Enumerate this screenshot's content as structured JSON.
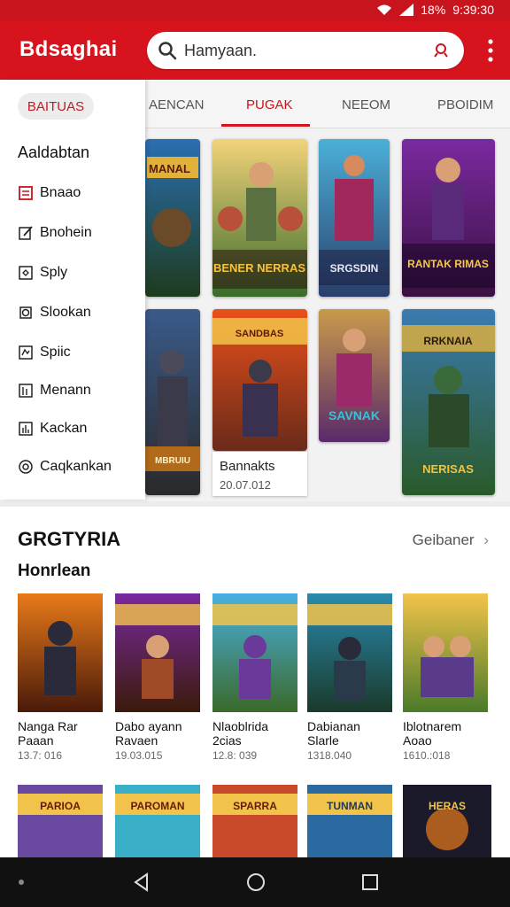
{
  "status": {
    "time": "9:39:30",
    "battery": "18%"
  },
  "appbar": {
    "title": "Bdsaghai",
    "search_placeholder": "Hamyaan."
  },
  "drawer": {
    "chip": "BAITUAS",
    "heading": "Aaldabtan",
    "items": [
      {
        "label": "Bnaao",
        "icon": "square-icon"
      },
      {
        "label": "Bnohein",
        "icon": "edit-icon"
      },
      {
        "label": "Sply",
        "icon": "puzzle-icon"
      },
      {
        "label": "Slookan",
        "icon": "target-icon"
      },
      {
        "label": "Spiic",
        "icon": "map-icon"
      },
      {
        "label": "Menann",
        "icon": "grid-icon"
      },
      {
        "label": "Kackan",
        "icon": "chart-icon"
      },
      {
        "label": "Caqkankan",
        "icon": "circle-icon"
      }
    ]
  },
  "tabs": [
    "AENCAN",
    "PUGAK",
    "NEEOM",
    "PBOIDIM"
  ],
  "featured": {
    "title": "Bannakts",
    "date": "20.07.012",
    "covers": [
      "MANAL",
      "BENER NERRAS",
      "SRGSDIN",
      "RANTAK RIMAS",
      "MBRUIU",
      "SANDBAS",
      "SAVNAK",
      "NERISAS"
    ]
  },
  "section": {
    "title": "GRGTYRIA",
    "link": "Geibaner",
    "subtitle": "Honrlean",
    "items": [
      {
        "name": "Nanga Rar",
        "sub": "Paaan",
        "meta": "13.7: 016"
      },
      {
        "name": "Dabo ayann",
        "sub": "Ravaen",
        "meta": "19.03.015"
      },
      {
        "name": "Nlaoblrida",
        "sub": "2cias",
        "meta": "12.8: 039"
      },
      {
        "name": "Dabianan",
        "sub": "Slarle",
        "meta": "1318.040"
      },
      {
        "name": "Iblotnarem",
        "sub": "Aoao",
        "meta": "1610.:018"
      }
    ],
    "row2_covers": [
      "PARIOA",
      "PAROMAN",
      "SPARRA",
      "TUNMAN",
      "HERAS"
    ]
  },
  "colors": {
    "accent": "#d7141d"
  }
}
